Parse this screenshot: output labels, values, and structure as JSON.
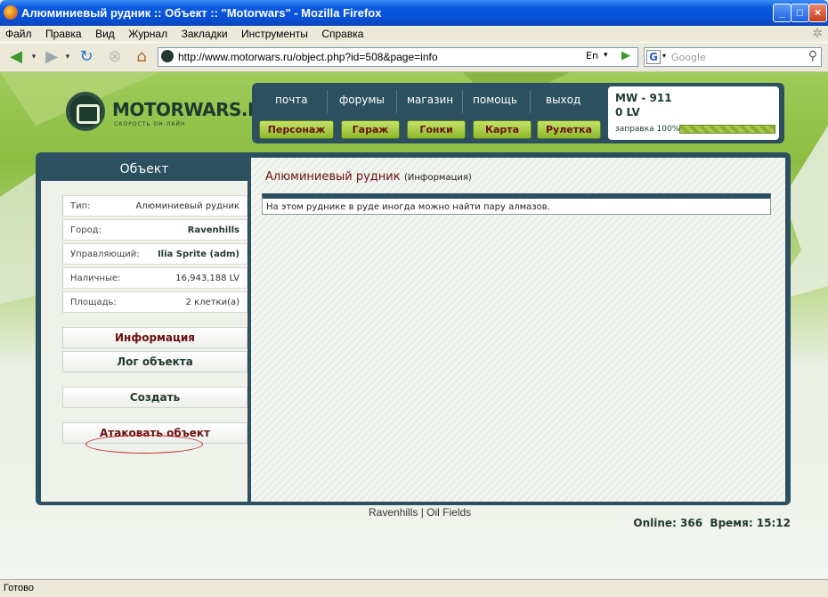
{
  "window": {
    "title": "Алюминиевый рудник :: Объект :: \"Motorwars\" - Mozilla Firefox"
  },
  "menu": [
    "Файл",
    "Правка",
    "Вид",
    "Журнал",
    "Закладки",
    "Инструменты",
    "Справка"
  ],
  "toolbar": {
    "url": "http://www.motorwars.ru/object.php?id=508&page=info",
    "lang": "En",
    "search_placeholder": "Google"
  },
  "site": {
    "logo_text": "MOTORWARS.RU",
    "logo_sub": "СКОРОСТЬ ОН-ЛАЙН",
    "top_links": [
      "почта",
      "форумы",
      "магазин",
      "помощь",
      "выход"
    ],
    "top_buttons": [
      "Персонаж",
      "Гараж",
      "Гонки",
      "Карта",
      "Рулетка"
    ],
    "player": {
      "name": "MW - 911",
      "money": "0 LV",
      "fuel_label": "заправка 100%",
      "fuel_level": 1.0
    }
  },
  "object_panel": {
    "title": "Объект",
    "rows": [
      {
        "key": "Тип:",
        "value": "Алюминиевый рудник"
      },
      {
        "key": "Город:",
        "value": "Ravenhills"
      },
      {
        "key": "Управляющий:",
        "value": "Ilia Sprite (adm)"
      },
      {
        "key": "Наличные:",
        "value": "16,943,188 LV"
      },
      {
        "key": "Площадь:",
        "value": "2 клетки(а)"
      }
    ],
    "actions": [
      "Информация",
      "Лог объекта",
      "Создать",
      "Атаковать объект"
    ]
  },
  "content": {
    "heading": "Алюминиевый рудник",
    "sub": "(Информация)",
    "text": "На этом руднике в руде иногда можно найти пару алмазов."
  },
  "footer": {
    "link1": "Ravenhills",
    "sep": "|",
    "link2": "Oil Fields",
    "online": "Online: 366  Время: 15:12"
  },
  "statusbar": "Готово"
}
